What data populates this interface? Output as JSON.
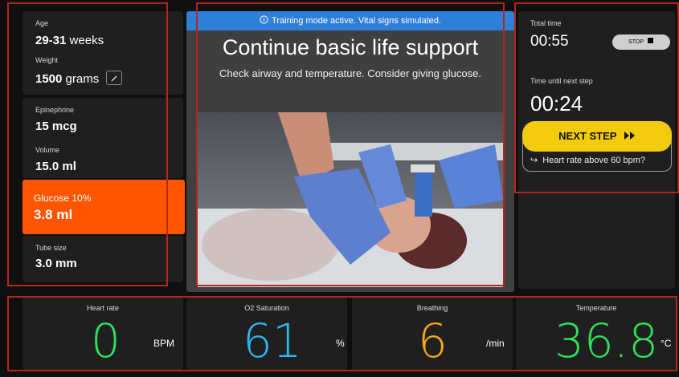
{
  "patient": {
    "age_label": "Age",
    "age_value": "29-31",
    "age_unit": "weeks",
    "weight_label": "Weight",
    "weight_value": "1500",
    "weight_unit": "grams"
  },
  "medication": {
    "epinephrine_label": "Epinephrine",
    "epinephrine_value": "15 mcg",
    "volume_label": "Volume",
    "volume_value": "15.0 ml",
    "glucose_label": "Glucose 10%",
    "glucose_value": "3.8 ml",
    "tube_label": "Tube size",
    "tube_value": "3.0 mm"
  },
  "main": {
    "banner": "Training mode active. Vital signs simulated.",
    "title": "Continue basic life support",
    "instruction": "Check airway and temperature. Consider giving glucose."
  },
  "timer": {
    "total_label": "Total time",
    "total_value": "00:55",
    "stop_label": "STOP",
    "next_label": "Time until next step",
    "next_value": "00:24",
    "next_button": "NEXT STEP",
    "next_condition": "Heart rate above 60 bpm?"
  },
  "vitals": [
    {
      "name": "Heart rate",
      "value": "0",
      "unit": "BPM",
      "color": "#2fe05a"
    },
    {
      "name": "O2 Saturation",
      "value": "61",
      "unit": "%",
      "color": "#2bb8f0"
    },
    {
      "name": "Breathing",
      "value": "6",
      "unit": "/min",
      "color": "#f5a81a"
    },
    {
      "name": "Temperature",
      "value": "36.8",
      "unit": "°C",
      "color": "#2fe05a"
    }
  ],
  "colors": {
    "glucose_highlight": "#ff5500",
    "banner": "#2d7fd8",
    "next_button": "#f2cc0c"
  },
  "icons": {
    "banner": "info-icon",
    "weight_edit": "pencil-icon",
    "stop": "stop-square-icon",
    "next": "fast-forward-icon",
    "condition": "arrow-right-hook-icon"
  }
}
